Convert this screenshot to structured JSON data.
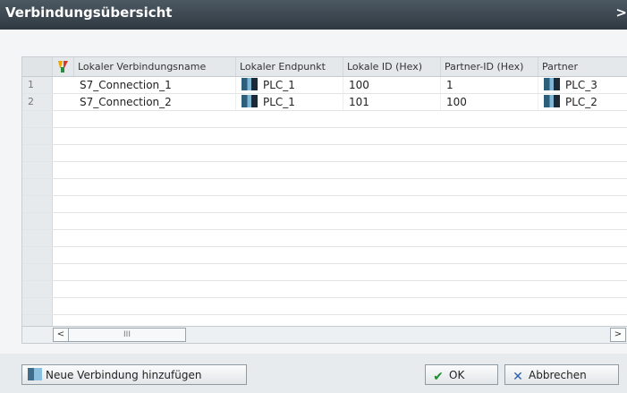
{
  "window": {
    "title": "Verbindungsübersicht",
    "close_glyph": ">"
  },
  "table": {
    "columns": [
      "Lokaler Verbindungsname",
      "Lokaler Endpunkt",
      "Lokale ID (Hex)",
      "Partner-ID (Hex)",
      "Partner"
    ],
    "rows": [
      {
        "num": "1",
        "name": "S7_Connection_1",
        "local_endpoint": "PLC_1",
        "local_id": "100",
        "partner_id": "1",
        "partner": "PLC_3"
      },
      {
        "num": "2",
        "name": "S7_Connection_2",
        "local_endpoint": "PLC_1",
        "local_id": "101",
        "partner_id": "100",
        "partner": "PLC_2"
      }
    ]
  },
  "scrollbar": {
    "left_arrow": "<",
    "thumb_grip": "III",
    "right_arrow": ">"
  },
  "footer": {
    "new_connection": "Neue Verbindung hinzufügen",
    "ok": "OK",
    "cancel": "Abbrechen"
  },
  "icons": {
    "plc": "plc-device-icon",
    "filter": "filter-icon",
    "new": "add-connection-icon",
    "ok": "checkmark-icon",
    "cancel": "x-icon"
  }
}
